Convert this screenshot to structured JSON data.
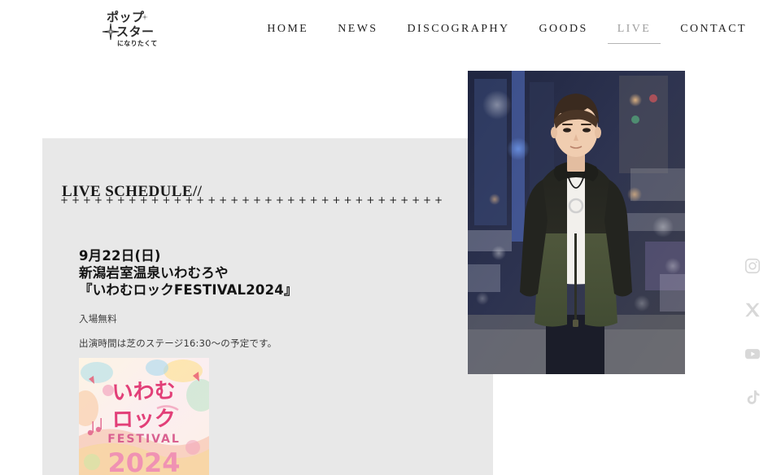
{
  "site": {
    "logo": {
      "line1": "ポップ",
      "line2": "スター",
      "line3": "になりたくて",
      "icon": "four-point-star"
    }
  },
  "nav": {
    "items": [
      {
        "label": "HOME",
        "active": false
      },
      {
        "label": "NEWS",
        "active": false
      },
      {
        "label": "DISCOGRAPHY",
        "active": false
      },
      {
        "label": "GOODS",
        "active": false
      },
      {
        "label": "LIVE",
        "active": true
      },
      {
        "label": "CONTACT",
        "active": false
      }
    ]
  },
  "panel": {
    "title": "LIVE SCHEDULE//",
    "divider_glyph": "+",
    "divider_count": 34,
    "background": "#e8e8e8"
  },
  "event": {
    "date": "9月22日(日)",
    "venue": "新潟岩室温泉いわむろや",
    "name": "『いわむロックFESTIVAL2024』",
    "admission": "入場無料",
    "time_note": "出演時間は芝のステージ16:30〜の予定です。",
    "poster_alt": "いわむロック FESTIVAL 2024 ポスター"
  },
  "photo": {
    "alt": "アーティスト写真 — 夜の街を背景に立つ男性"
  },
  "social": {
    "items": [
      {
        "name": "instagram",
        "label": "Instagram"
      },
      {
        "name": "x-twitter",
        "label": "X"
      },
      {
        "name": "youtube",
        "label": "YouTube"
      },
      {
        "name": "tiktok",
        "label": "TikTok"
      }
    ],
    "color": "#d8d8d8"
  }
}
